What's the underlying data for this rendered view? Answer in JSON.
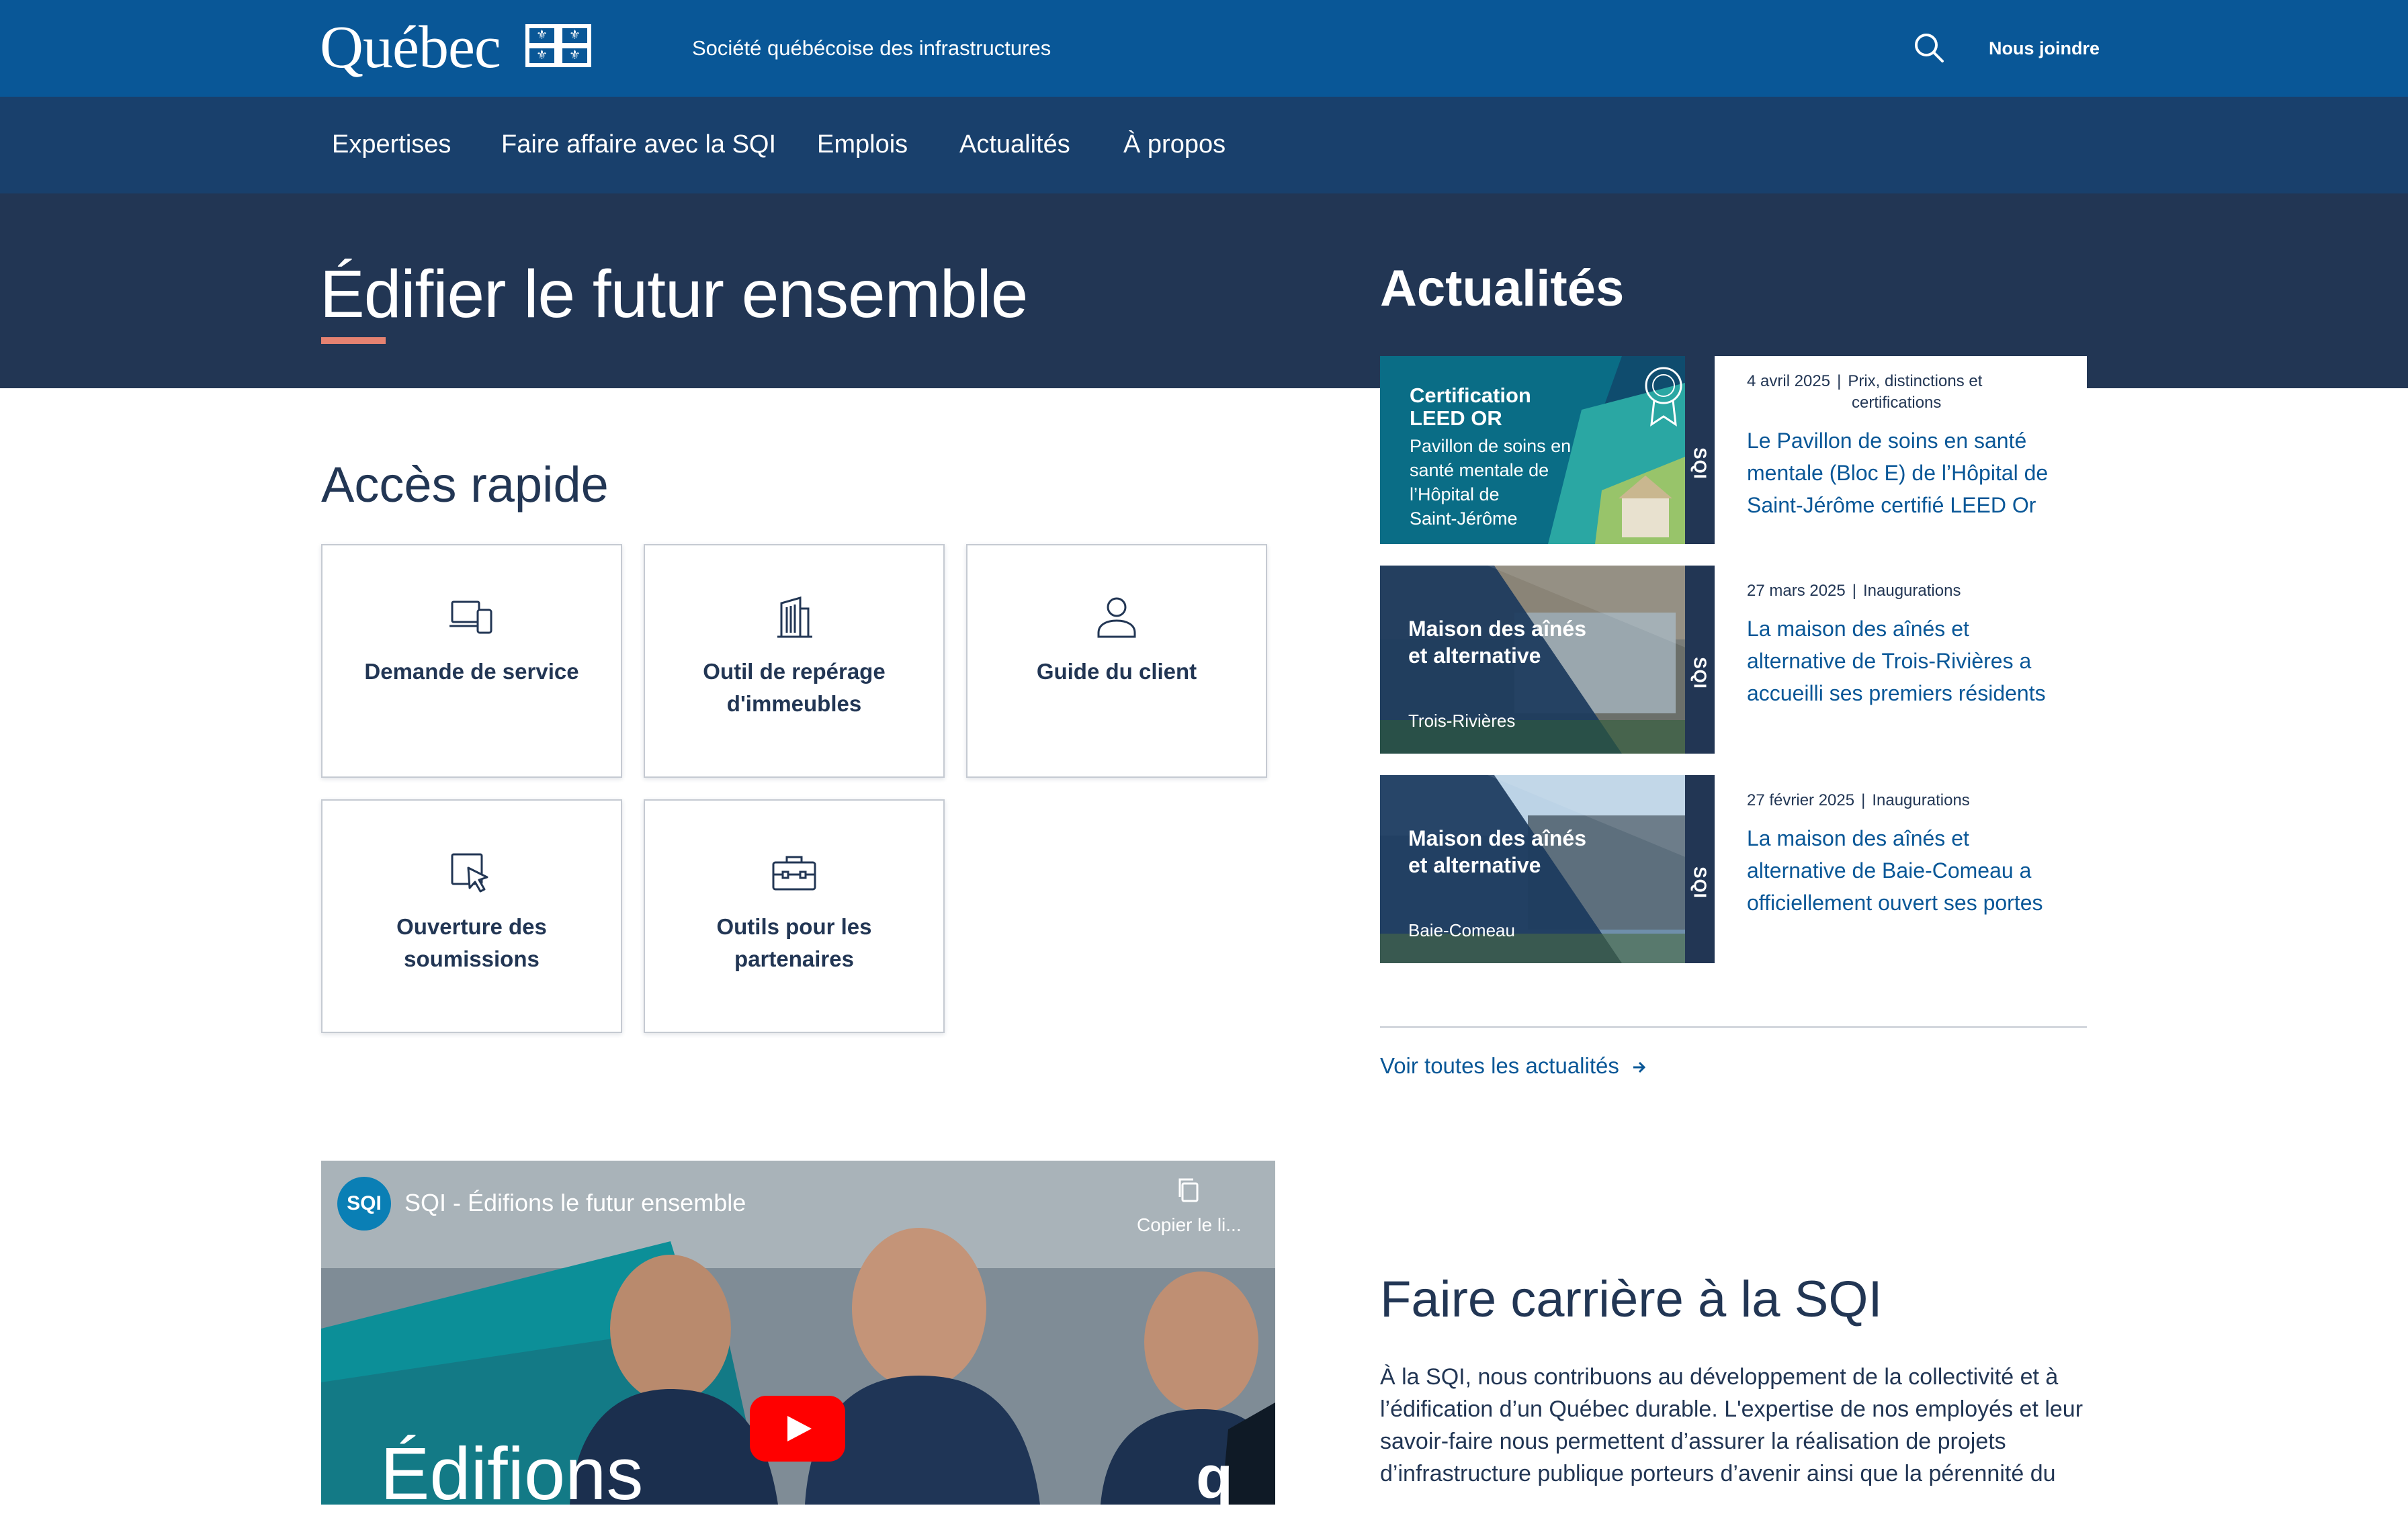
{
  "header": {
    "logo_text": "Québec",
    "org_name": "Société québécoise des infrastructures",
    "contact_label": "Nous joindre",
    "search_icon": "search-icon",
    "brand_color": "#095797"
  },
  "nav": {
    "items": [
      "Expertises",
      "Faire affaire avec la SQI",
      "Emplois",
      "Actualités",
      "À propos"
    ]
  },
  "hero": {
    "title": "Édifier le futur ensemble",
    "accent_color": "#e58271"
  },
  "quick_access": {
    "heading": "Accès rapide",
    "tiles": [
      {
        "label": "Demande de service",
        "icon": "devices-icon"
      },
      {
        "label": "Outil de repérage d'immeubles",
        "icon": "building-icon"
      },
      {
        "label": "Guide du client",
        "icon": "person-icon"
      },
      {
        "label": "Ouverture des soumissions",
        "icon": "cursor-click-icon"
      },
      {
        "label": "Outils pour les partenaires",
        "icon": "briefcase-icon"
      }
    ]
  },
  "news": {
    "heading": "Actualités",
    "items": [
      {
        "date": "4 avril 2025",
        "category_line1": "Prix, distinctions et",
        "category_line2": "certifications",
        "title": "Le Pavillon de soins en santé mentale (Bloc E) de l’Hôpital de Saint-Jérôme certifié LEED Or",
        "thumb_title_1": "Certification",
        "thumb_title_2": "LEED OR",
        "thumb_sub_1": "Pavillon de soins en",
        "thumb_sub_2": "santé mentale de",
        "thumb_sub_3": "l’Hôpital de",
        "thumb_sub_4": "Saint-Jérôme",
        "thumb_brand": "SQI"
      },
      {
        "date": "27 mars 2025",
        "category": "Inaugurations",
        "title": "La maison des aînés et alternative de Trois-Rivières a accueilli ses premiers résidents",
        "thumb_title_1": "Maison des aînés",
        "thumb_title_2": "et alternative",
        "thumb_place": "Trois-Rivières",
        "thumb_brand": "SQI"
      },
      {
        "date": "27 février 2025",
        "category": "Inaugurations",
        "title": "La maison des aînés et alternative de Baie-Comeau a officiellement ouvert ses portes",
        "thumb_title_1": "Maison des aînés",
        "thumb_title_2": "et alternative",
        "thumb_place": "Baie-Comeau",
        "thumb_brand": "SQI"
      }
    ],
    "see_all": "Voir toutes les actualités",
    "see_all_icon": "arrow-right-icon"
  },
  "video": {
    "channel": "SQI",
    "title": "SQI - Édifions le futur ensemble",
    "copy_label": "Copier le li...",
    "overlay_text": "Édifions",
    "corner_mark": "q",
    "play_icon": "youtube-play-icon"
  },
  "careers": {
    "heading": "Faire carrière à la SQI",
    "text": "À la SQI, nous contribuons au développement de la collectivité et à l’édification d’un Québec durable. L'expertise de nos employés et leur savoir-faire nous permettent d’assurer la réalisation de projets d’infrastructure publique porteurs d’avenir ainsi que la pérennité du"
  }
}
